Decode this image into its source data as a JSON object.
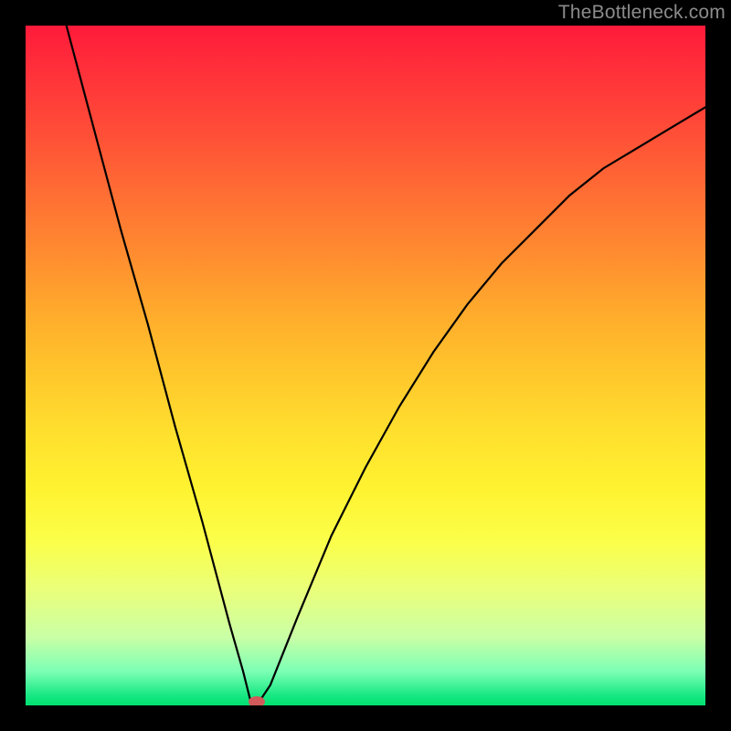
{
  "watermark": "TheBottleneck.com",
  "colors": {
    "frame": "#000000",
    "gradient_top": "#ff1a3a",
    "gradient_bottom": "#00e070",
    "curve": "#000000",
    "marker": "#d15a5a",
    "watermark": "#8c8c8c"
  },
  "chart_data": {
    "type": "line",
    "title": "",
    "xlabel": "",
    "ylabel": "",
    "xlim": [
      0,
      100
    ],
    "ylim": [
      0,
      100
    ],
    "grid": false,
    "legend": false,
    "background": "rainbow-vertical",
    "x": [
      6,
      10,
      14,
      18,
      22,
      26,
      30,
      32,
      33,
      34,
      36,
      40,
      45,
      50,
      55,
      60,
      65,
      70,
      75,
      80,
      85,
      90,
      95,
      100
    ],
    "values": [
      100,
      85,
      70,
      56,
      41,
      27,
      12,
      5,
      1,
      0,
      3,
      13,
      25,
      35,
      44,
      52,
      59,
      65,
      70,
      75,
      79,
      82,
      85,
      88
    ],
    "marker": {
      "x": 34,
      "y": 0
    },
    "notes": "V-shaped bottleneck curve; y is mismatch percentage. Minimum (optimal) at x≈34."
  }
}
